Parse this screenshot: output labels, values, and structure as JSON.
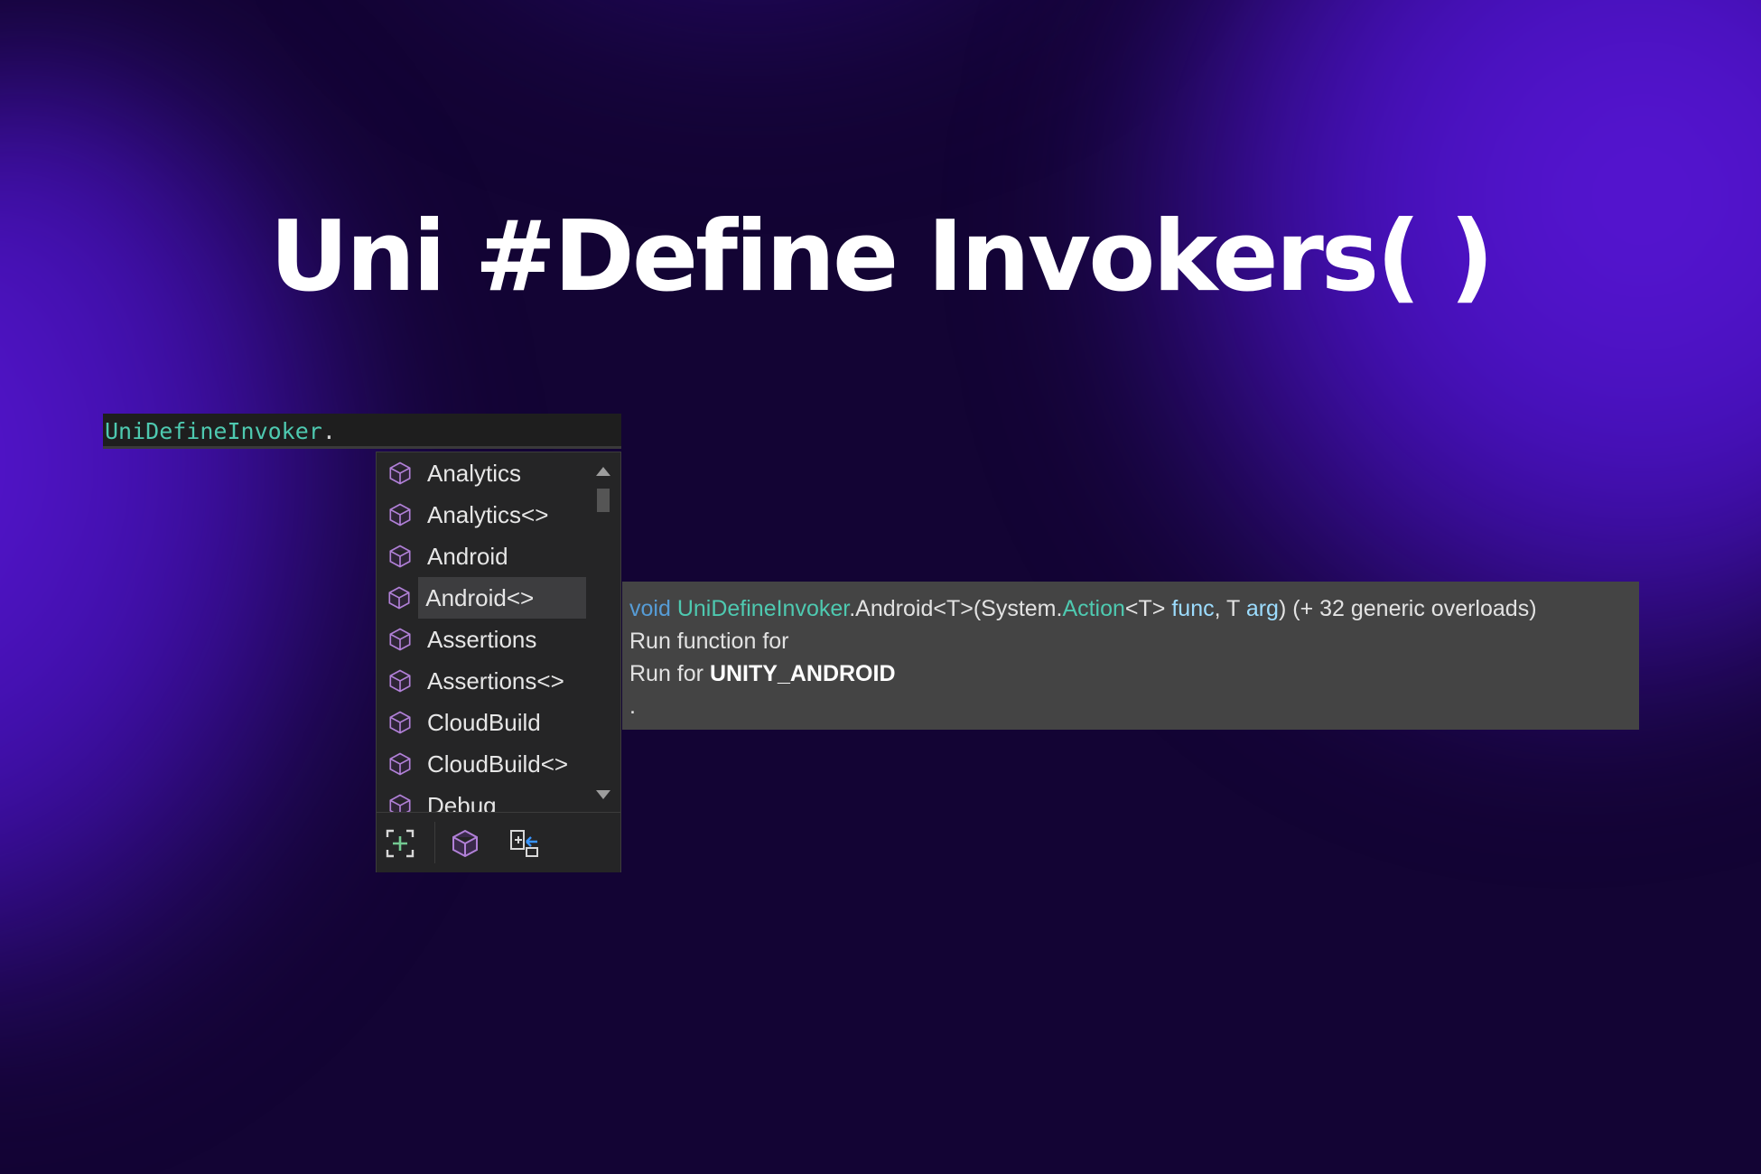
{
  "title": "Uni #Define Invokers( )",
  "editor": {
    "class_name": "UniDefineInvoker",
    "dot": "."
  },
  "completion": {
    "items": [
      {
        "label": "Analytics"
      },
      {
        "label": "Analytics<>"
      },
      {
        "label": "Android"
      },
      {
        "label": "Android<>",
        "selected": true
      },
      {
        "label": "Assertions"
      },
      {
        "label": "Assertions<>"
      },
      {
        "label": "CloudBuild"
      },
      {
        "label": "CloudBuild<>"
      },
      {
        "label": "Debug"
      }
    ],
    "item_icon": "class-cube-icon",
    "toolbar": [
      "expand-filter-icon",
      "class-filter-icon",
      "extension-methods-icon"
    ]
  },
  "tooltip": {
    "signature": {
      "void": "void",
      "type": "UniDefineInvoker",
      "dot1": ".",
      "method": "Android",
      "generic": "<T>(System.",
      "action": "Action",
      "action_generic": "<T> ",
      "p1": "func",
      "comma": ", T ",
      "p2": "arg",
      "tail": ") (+ 32 generic overloads)"
    },
    "line2": "Run function for",
    "line3_prefix": "Run for ",
    "line3_bold": "UNITY_ANDROID",
    "line4": "."
  },
  "colors": {
    "background": "#130434",
    "accent_purple": "#5a16d8",
    "type_color": "#4ec9b0",
    "keyword_color": "#569cd6",
    "param_color": "#9cdcfe"
  }
}
